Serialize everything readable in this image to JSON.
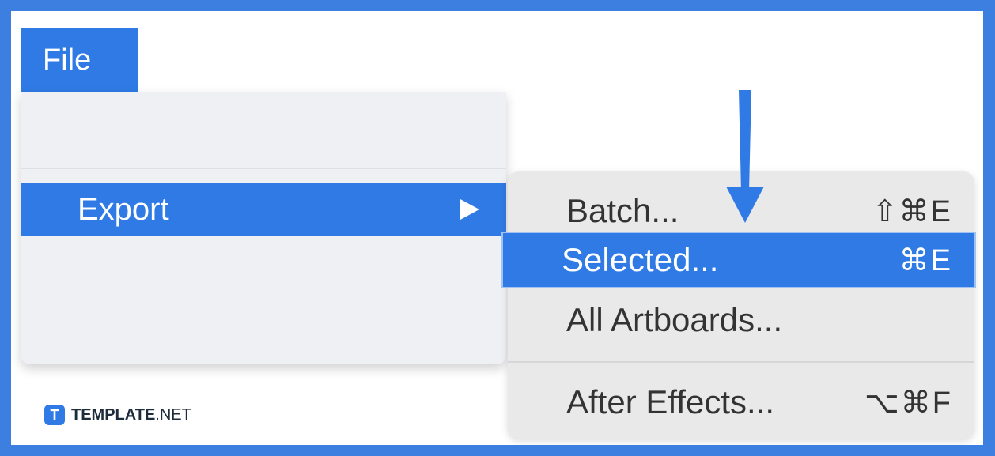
{
  "menu_bar": {
    "file_label": "File"
  },
  "main_menu": {
    "export_label": "Export",
    "submenu_indicator_icon": "triangle-right-icon"
  },
  "export_submenu": {
    "items": [
      {
        "label": "Batch...",
        "shortcut": "⇧⌘E"
      },
      {
        "label": "Selected...",
        "shortcut": "⌘E",
        "selected": true
      },
      {
        "label": "All Artboards...",
        "shortcut": ""
      },
      {
        "label": "After Effects...",
        "shortcut": "⌥⌘F"
      }
    ]
  },
  "annotation": {
    "icon": "down-arrow-icon"
  },
  "watermark": {
    "badge": "T",
    "brand_bold": "TEMPLATE",
    "brand_suffix": ".NET"
  },
  "colors": {
    "accent": "#2f7ae5",
    "frame": "#3d7fe0",
    "menu_bg": "#eef0f4",
    "submenu_bg": "#e9e9ea"
  }
}
